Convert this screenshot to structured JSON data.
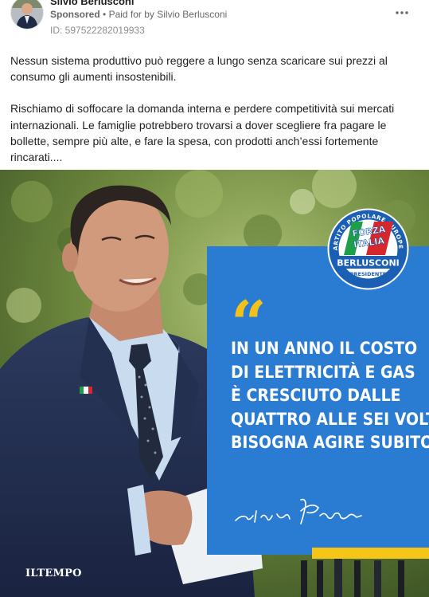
{
  "post": {
    "page_name": "Silvio Berlusconi",
    "sponsored_label": "Sponsored",
    "paid_for_text": "Paid for by Silvio Berlusconi",
    "separator": "•",
    "ad_id": "ID: 597522282019933",
    "more_icon": "more-horizontal-icon",
    "paragraphs": [
      "Nessun sistema produttivo può reggere a lungo senza scaricare sui prezzi al consumo gli aumenti insostenibili.",
      "Rischiamo di soffocare la domanda interna e perdere competitività sui mercati internazionali. Le famiglie potrebbero trovarsi a dover scegliere fra pagare le bollette, sempre più alte, e fare la spesa, con prodotti anch’essi fortemente rincarati...."
    ]
  },
  "creative": {
    "quote_glyph": "“",
    "headline_lines": [
      "IN UN ANNO IL COSTO",
      "DI ELETTRICITÀ E GAS",
      "È CRESCIUTO DALLE",
      "QUATTRO ALLE SEI VOLTE.",
      "BISOGNA AGIRE SUBITO."
    ],
    "signature_icon": "signature-icon",
    "watermark": "ILTEMPO",
    "logo": {
      "ring_text": "PARTITO POPOLARE EUROPEO",
      "forza": "FORZA",
      "italia": "ITALIA",
      "name": "BERLUSCONI",
      "role": "PRESIDENTE"
    },
    "colors": {
      "panel_blue": "#2a7cd3",
      "quote_yellow": "#f2c21b",
      "strip_yellow": "#f5c518",
      "logo_blue": "#1b5fb4",
      "flag_green": "#1e9e49",
      "flag_red": "#d7262c"
    }
  }
}
